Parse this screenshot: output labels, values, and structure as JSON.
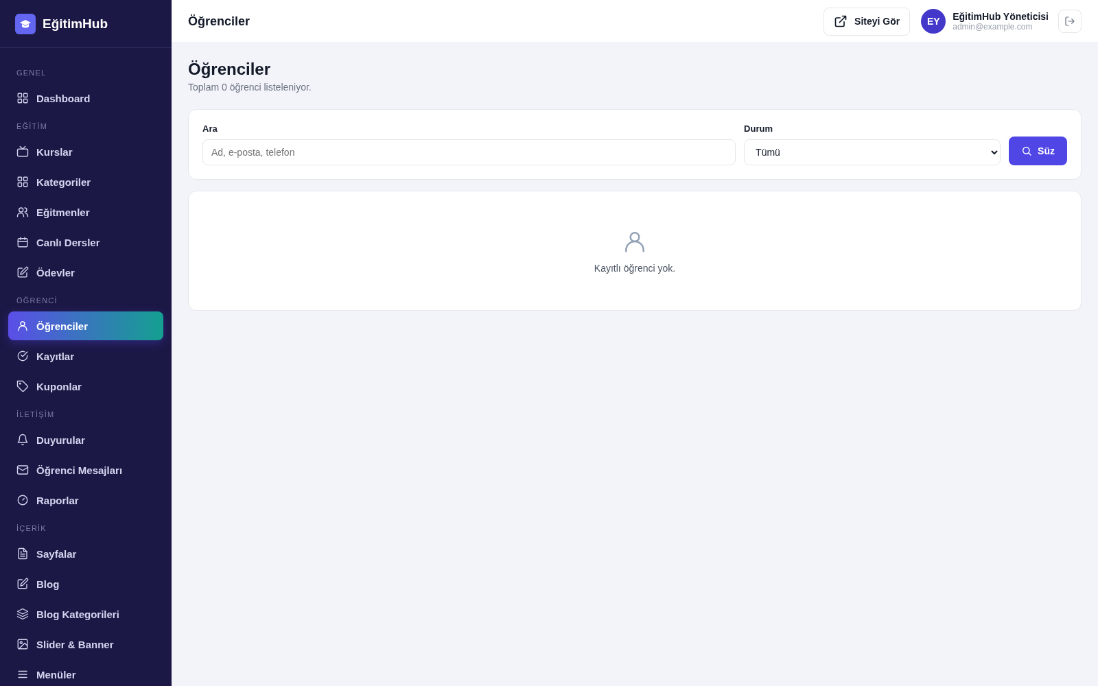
{
  "brand": {
    "name": "EğitimHub"
  },
  "sidebar": {
    "sections": [
      {
        "title": "GENEL",
        "items": [
          {
            "label": "Dashboard",
            "selected": false
          }
        ]
      },
      {
        "title": "EĞİTİM",
        "items": [
          {
            "label": "Kurslar",
            "selected": false
          },
          {
            "label": "Kategoriler",
            "selected": false
          },
          {
            "label": "Eğitmenler",
            "selected": false
          },
          {
            "label": "Canlı Dersler",
            "selected": false
          },
          {
            "label": "Ödevler",
            "selected": false
          }
        ]
      },
      {
        "title": "ÖĞRENCİ",
        "items": [
          {
            "label": "Öğrenciler",
            "selected": true
          },
          {
            "label": "Kayıtlar",
            "selected": false
          },
          {
            "label": "Kuponlar",
            "selected": false
          }
        ]
      },
      {
        "title": "İLETİŞİM",
        "items": [
          {
            "label": "Duyurular",
            "selected": false
          },
          {
            "label": "Öğrenci Mesajları",
            "selected": false
          },
          {
            "label": "Raporlar",
            "selected": false
          }
        ]
      },
      {
        "title": "İÇERİK",
        "items": [
          {
            "label": "Sayfalar",
            "selected": false
          },
          {
            "label": "Blog",
            "selected": false
          },
          {
            "label": "Blog Kategorileri",
            "selected": false
          },
          {
            "label": "Slider & Banner",
            "selected": false
          },
          {
            "label": "Menüler",
            "selected": false
          }
        ]
      }
    ]
  },
  "header": {
    "title": "Öğrenciler",
    "site_button": "Siteyi Gör",
    "user": {
      "initials": "EY",
      "name": "EğitimHub Yöneticisi",
      "email": "admin@example.com"
    }
  },
  "page": {
    "title": "Öğrenciler",
    "subtitle": "Toplam 0 öğrenci listeleniyor."
  },
  "filters": {
    "search": {
      "label": "Ara",
      "placeholder": "Ad, e-posta, telefon"
    },
    "status": {
      "label": "Durum",
      "value": "Tümü"
    },
    "button": "Süz"
  },
  "empty_state": {
    "message": "Kayıtlı öğrenci yok."
  }
}
